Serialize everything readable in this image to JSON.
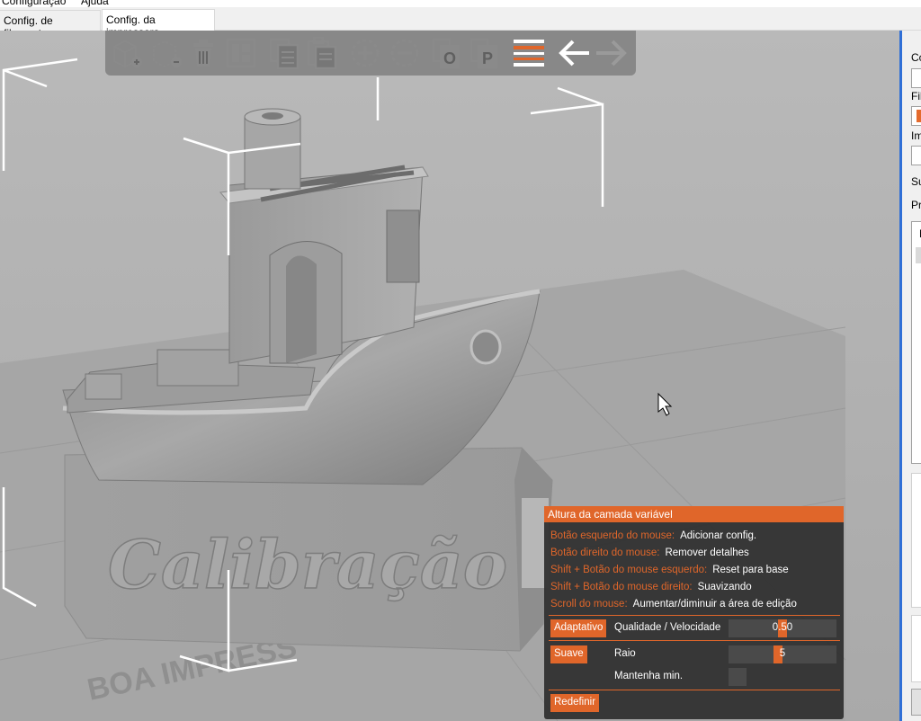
{
  "menubar": {
    "items": [
      "Configuração",
      "Ajuda"
    ]
  },
  "tabs": [
    {
      "label": "Config. de filamento"
    },
    {
      "label": "Config. da impressora"
    }
  ],
  "right_panel": {
    "labels": [
      "Co",
      "Fil",
      "Im",
      "Su",
      "Pr",
      "N"
    ]
  },
  "viewport": {
    "base_text": "Calibração",
    "bed_text": "BOA IMPRESS"
  },
  "toolbar": {
    "icons": [
      "add-object-icon",
      "remove-object-icon",
      "delete-all-icon",
      "arrange-icon",
      "copy-icon",
      "paste-icon",
      "add-instance-icon",
      "remove-instance-icon",
      "split-objects-icon",
      "split-parts-icon",
      "variable-layer-height-icon",
      "undo-icon",
      "redo-icon"
    ]
  },
  "variable_layer_dialog": {
    "title": "Altura da camada variável",
    "help": [
      {
        "key": "Botão esquerdo do mouse:",
        "value": "Adicionar config."
      },
      {
        "key": "Botão direito do mouse:",
        "value": "Remover detalhes"
      },
      {
        "key": "Shift + Botão do mouse esquerdo:",
        "value": "Reset para base"
      },
      {
        "key": "Shift + Botão do mouse direito:",
        "value": "Suavizando"
      },
      {
        "key": "Scroll do mouse:",
        "value": "Aumentar/diminuir a área de edição"
      }
    ],
    "adaptive_button": "Adaptativo",
    "quality_label": "Qualidade / Velocidade",
    "quality_value": "0.50",
    "quality_fraction": 0.5,
    "smooth_button": "Suave",
    "radius_label": "Raio",
    "radius_value": "5",
    "radius_fraction": 0.45,
    "keep_min_label": "Mantenha min.",
    "reset_button": "Redefinir"
  },
  "colors": {
    "accent": "#e0662a",
    "viewport_bg": "#b3b3b3",
    "selection_blue": "#2f6fd6"
  }
}
